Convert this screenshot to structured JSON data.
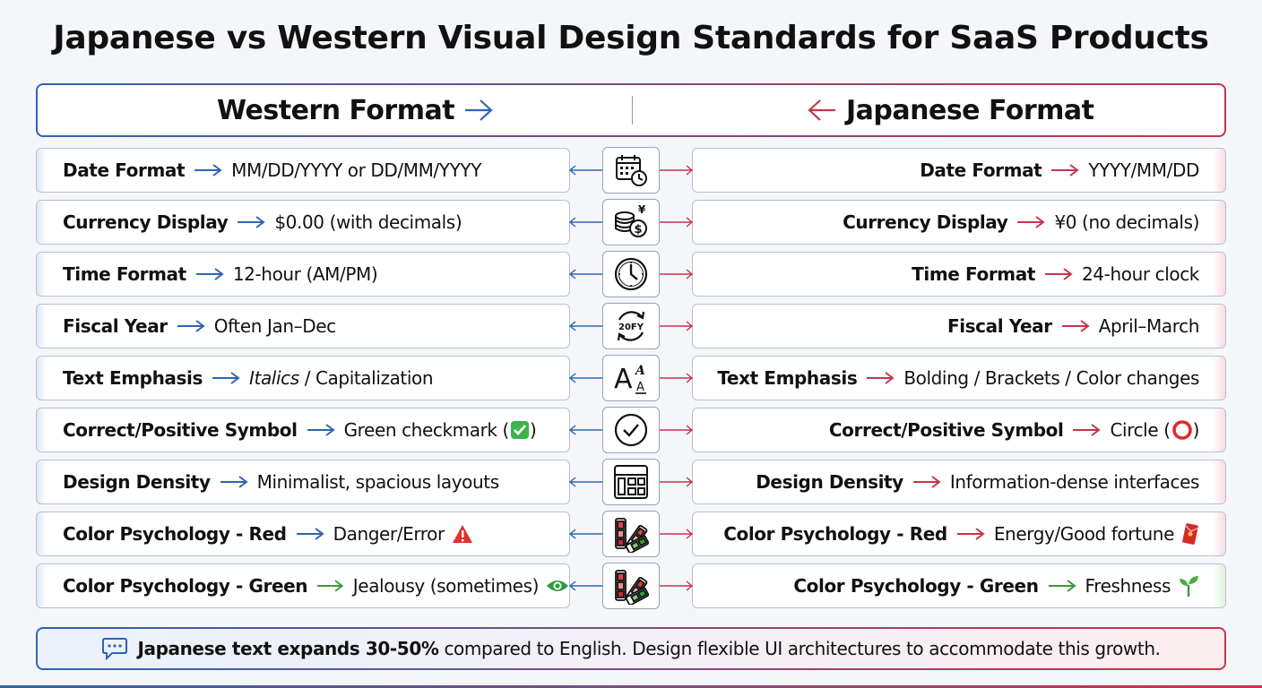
{
  "title": "Japanese vs Western Visual Design Standards for SaaS Products",
  "header": {
    "western": "Western Format",
    "japanese": "Japanese Format"
  },
  "colors": {
    "western_accent": "#2f63b3",
    "japanese_accent": "#c8354a",
    "green_accent": "#3a9a3a"
  },
  "rows": [
    {
      "icon": "calendar-clock-icon",
      "western": {
        "label": "Date Format",
        "value": "MM/DD/YYYY or DD/MM/YYYY"
      },
      "japanese": {
        "label": "Date Format",
        "value": "YYYY/MM/DD"
      }
    },
    {
      "icon": "coins-currency-icon",
      "western": {
        "label": "Currency Display",
        "value": "$0.00 (with decimals)"
      },
      "japanese": {
        "label": "Currency Display",
        "value": "¥0 (no decimals)"
      }
    },
    {
      "icon": "clock-icon",
      "western": {
        "label": "Time Format",
        "value": "12-hour (AM/PM)"
      },
      "japanese": {
        "label": "Time Format",
        "value": "24-hour clock"
      }
    },
    {
      "icon": "fiscal-year-cycle-icon",
      "icon_text": "20FY",
      "western": {
        "label": "Fiscal Year",
        "value": "Often Jan–Dec"
      },
      "japanese": {
        "label": "Fiscal Year",
        "value": "April–March"
      }
    },
    {
      "icon": "text-emphasis-icon",
      "western": {
        "label": "Text Emphasis",
        "value_italic": "Italics",
        "value": " / Capitalization"
      },
      "japanese": {
        "label": "Text Emphasis",
        "value": "Bolding / Brackets / Color changes"
      }
    },
    {
      "icon": "check-circle-icon",
      "western": {
        "label": "Correct/Positive Symbol",
        "value": "Green checkmark (",
        "value_end": ")",
        "emoji": "green-checkmark-icon"
      },
      "japanese": {
        "label": "Correct/Positive Symbol",
        "value": "Circle (",
        "value_end": ")",
        "emoji": "red-circle-icon"
      }
    },
    {
      "icon": "layout-grid-icon",
      "western": {
        "label": "Design Density",
        "value": "Minimalist, spacious layouts"
      },
      "japanese": {
        "label": "Design Density",
        "value": "Information-dense interfaces"
      }
    },
    {
      "icon": "color-swatch-icon",
      "western": {
        "label": "Color Psychology - Red",
        "value": "Danger/Error",
        "emoji": "warning-icon"
      },
      "japanese": {
        "label": "Color Psychology - Red",
        "value": "Energy/Good fortune",
        "emoji": "red-envelope-icon"
      }
    },
    {
      "icon": "color-swatch-icon",
      "western": {
        "label": "Color Psychology - Green",
        "value": "Jealousy (sometimes)",
        "emoji": "eye-icon"
      },
      "japanese": {
        "label": "Color Psychology - Green",
        "value": "Freshness",
        "emoji": "sprout-icon"
      }
    }
  ],
  "footer": {
    "icon": "chat-bubble-icon",
    "bold": "Japanese text expands 30-50%",
    "text": " compared to English. Design flexible UI architectures to accommodate this growth."
  }
}
